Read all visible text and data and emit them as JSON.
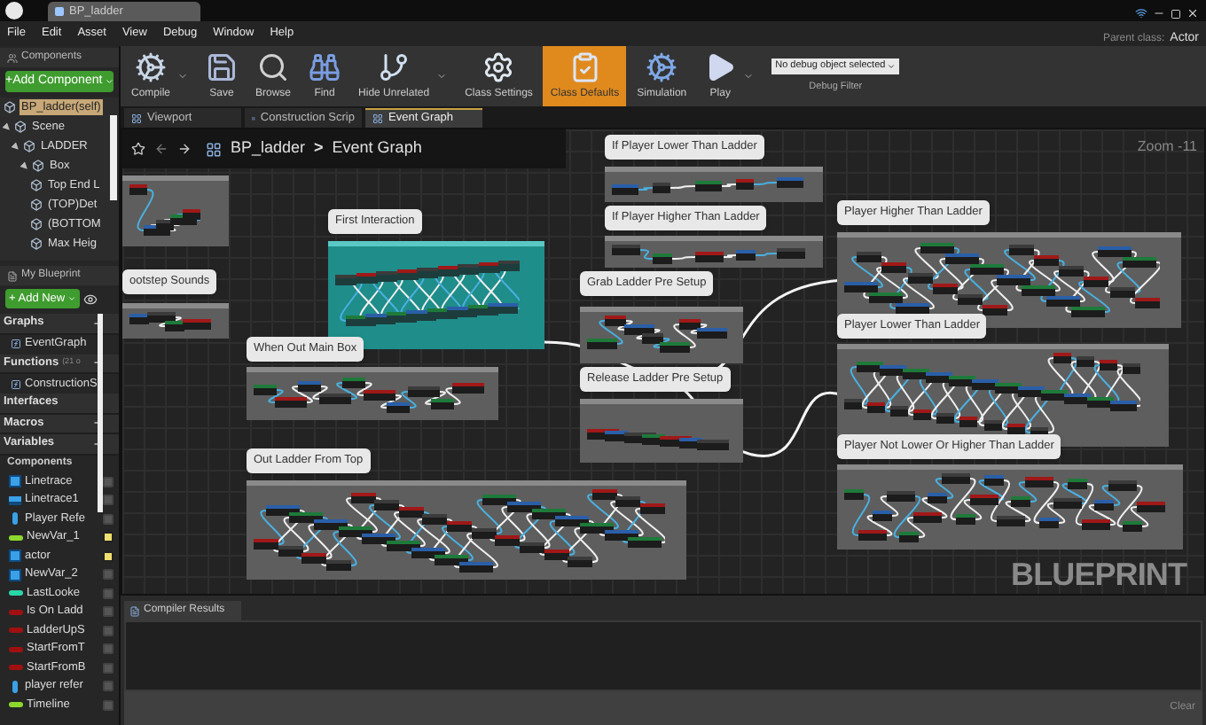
{
  "window": {
    "tab": "BP_ladder",
    "menu": [
      "File",
      "Edit",
      "Asset",
      "View",
      "Debug",
      "Window",
      "Help"
    ],
    "parent_class_label": "Parent class:",
    "parent_class": "Actor"
  },
  "components": {
    "title": "Components",
    "add_button": "+Add Component",
    "tree": [
      {
        "label": "BP_ladder(self)",
        "selected": true
      },
      {
        "label": "Scene",
        "selected": false,
        "expanded": true,
        "children": [
          {
            "label": "LADDER",
            "selected": false,
            "expanded": true,
            "children": [
              {
                "label": "Box",
                "selected": false,
                "expanded": true,
                "children": [
                  {
                    "label": "Top End L",
                    "selected": false
                  },
                  {
                    "label": "(TOP)Det",
                    "selected": false
                  },
                  {
                    "label": "(BOTTOM",
                    "selected": false
                  },
                  {
                    "label": "Max Heig",
                    "selected": false
                  }
                ]
              }
            ]
          }
        ]
      }
    ]
  },
  "toolbar": [
    {
      "kind": "compile",
      "label": "Compile",
      "selected": false,
      "menu": true
    },
    {
      "kind": "save",
      "label": "Save",
      "selected": false,
      "menu": false
    },
    {
      "kind": "browse",
      "label": "Browse",
      "selected": false,
      "menu": false
    },
    {
      "kind": "find",
      "label": "Find",
      "selected": false,
      "menu": false
    },
    {
      "kind": "hide",
      "label": "Hide Unrelated",
      "selected": false,
      "menu": true
    },
    {
      "kind": "settings",
      "label": "Class Settings",
      "selected": false,
      "menu": false
    },
    {
      "kind": "defaults",
      "label": "Class Defaults",
      "selected": true,
      "menu": false
    },
    {
      "kind": "simulation",
      "label": "Simulation",
      "selected": false,
      "menu": false
    },
    {
      "kind": "play",
      "label": "Play",
      "selected": false,
      "menu": true
    }
  ],
  "debug_filter": {
    "value": "No debug object selected",
    "label": "Debug Filter"
  },
  "my_blueprint": {
    "title": "My Blueprint",
    "add_button": "+ Add New",
    "rows": [
      {
        "kind": "section",
        "label": "Graphs",
        "add": true
      },
      {
        "kind": "item",
        "label": "EventGraph"
      },
      {
        "kind": "section",
        "label": "Functions",
        "note": "(21 o",
        "add": true
      },
      {
        "kind": "item",
        "label": "ConstructionS"
      },
      {
        "kind": "section",
        "label": "Interfaces",
        "add": false
      },
      {
        "kind": "section",
        "label": "Macros",
        "add": true
      },
      {
        "kind": "section",
        "label": "Variables",
        "add": true
      },
      {
        "kind": "subsection",
        "label": "Components"
      }
    ],
    "variables": [
      {
        "kind": "struct",
        "label": "Linetrace",
        "color": "#3aa0e8",
        "exposed": false
      },
      {
        "kind": "array",
        "label": "Linetrace1",
        "color": "#3aa0e8",
        "exposed": false
      },
      {
        "kind": "object",
        "label": "Player Refe",
        "color": "#3aa0e8",
        "exposed": false
      },
      {
        "kind": "value",
        "label": "NewVar_1",
        "color": "#8cd82c",
        "exposed": true
      },
      {
        "kind": "struct",
        "label": "actor",
        "color": "#3aa0e8",
        "exposed": true
      },
      {
        "kind": "struct",
        "label": "NewVar_2",
        "color": "#3aa0e8",
        "exposed": false
      },
      {
        "kind": "value",
        "label": "LastLooke",
        "color": "#2ad6a8",
        "exposed": false
      },
      {
        "kind": "value",
        "label": "Is On Ladd",
        "color": "#a01010",
        "exposed": false
      },
      {
        "kind": "value",
        "label": "LadderUpS",
        "color": "#a01010",
        "exposed": false
      },
      {
        "kind": "value",
        "label": "StartFromT",
        "color": "#a01010",
        "exposed": false
      },
      {
        "kind": "value",
        "label": "StartFromB",
        "color": "#a01010",
        "exposed": false
      },
      {
        "kind": "object",
        "label": "player refer",
        "color": "#3aa0e8",
        "exposed": false
      },
      {
        "kind": "value",
        "label": "Timeline",
        "color": "#8cd82c",
        "exposed": false
      }
    ]
  },
  "editor_tabs": [
    {
      "label": "Viewport",
      "selected": false
    },
    {
      "label": "Construction Scrip",
      "selected": false
    },
    {
      "label": "Event Graph",
      "selected": true
    }
  ],
  "graph": {
    "breadcrumb": [
      "BP_ladder",
      "Event Graph"
    ],
    "separator": ">",
    "zoom": "Zoom -11",
    "watermark": "BLUEPRINT",
    "comments": [
      {
        "kind": "plain"
      },
      {
        "kind": "plain",
        "title": "ootstep Sounds"
      },
      {
        "kind": "teal",
        "title": "First Interaction"
      },
      {
        "kind": "plain",
        "title": "When Out Main Box"
      },
      {
        "kind": "plain",
        "title": "Out Ladder From Top"
      },
      {
        "kind": "plain",
        "title": "If Player Lower Than Ladder"
      },
      {
        "kind": "plain",
        "title": "If Player Higher Than Ladder"
      },
      {
        "kind": "plain",
        "title": "Grab Ladder Pre Setup"
      },
      {
        "kind": "plain",
        "title": "Release Ladder Pre Setup"
      },
      {
        "kind": "plain",
        "title": "Player Higher Than Ladder"
      },
      {
        "kind": "plain",
        "title": "Player Lower Than Ladder"
      },
      {
        "kind": "plain",
        "title": "Player Not Lower Or Higher Than Ladder"
      }
    ]
  },
  "compiler": {
    "tab": "Compiler Results",
    "clear": "Clear"
  }
}
